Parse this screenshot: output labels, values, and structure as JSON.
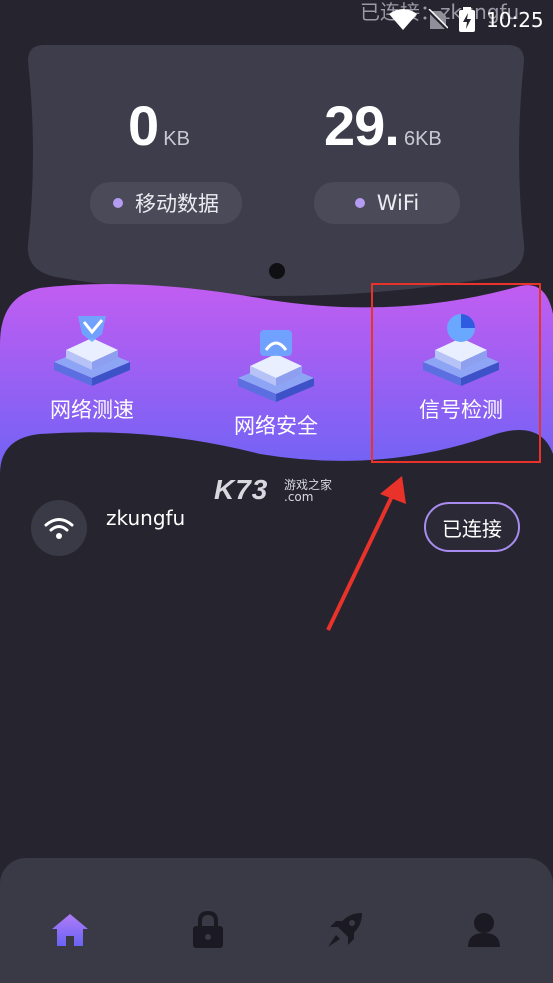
{
  "status_bar": {
    "ghost_text": "已连接：zkungfu",
    "time": "10:25"
  },
  "stats": {
    "mobile": {
      "value": "0",
      "unit": "KB",
      "label": "移动数据"
    },
    "wifi": {
      "value": "29.",
      "unit": "6KB",
      "label": "WiFi"
    }
  },
  "features": [
    {
      "label": "网络测速",
      "icon": "speed-test-icon"
    },
    {
      "label": "网络安全",
      "icon": "network-security-icon"
    },
    {
      "label": "信号检测",
      "icon": "signal-detection-icon"
    }
  ],
  "network": {
    "ssid": "zkungfu",
    "status_button": "已连接"
  },
  "watermark": {
    "main": "K73",
    "sub": "游戏之家",
    "domain": ".com"
  },
  "nav": [
    {
      "name": "home",
      "icon": "home-icon",
      "active": true
    },
    {
      "name": "lock",
      "icon": "lock-icon",
      "active": false
    },
    {
      "name": "rocket",
      "icon": "rocket-icon",
      "active": false
    },
    {
      "name": "profile",
      "icon": "user-icon",
      "active": false
    }
  ],
  "colors": {
    "background": "#26252f",
    "card": "#3e3d4b",
    "accent_purple": "#a98cf0",
    "banner_top": "#c15cf0",
    "banner_bottom": "#6c64f4",
    "annotation_red": "#e8322a"
  }
}
